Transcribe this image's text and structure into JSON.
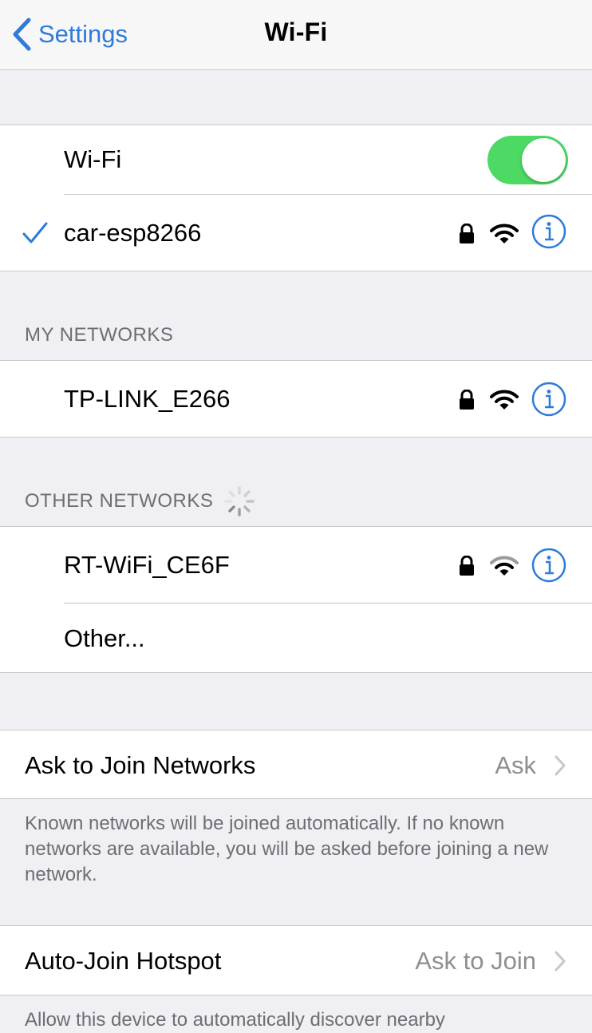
{
  "nav": {
    "back_label": "Settings",
    "title": "Wi-Fi"
  },
  "wifi_toggle": {
    "label": "Wi-Fi",
    "on": true,
    "color": "#4cd964"
  },
  "connected_network": {
    "name": "car-esp8266",
    "secured": true
  },
  "my_networks": {
    "header": "MY NETWORKS",
    "items": [
      {
        "name": "TP-LINK_E266",
        "secured": true
      }
    ]
  },
  "other_networks": {
    "header": "OTHER NETWORKS",
    "items": [
      {
        "name": "RT-WiFi_CE6F",
        "secured": true
      }
    ],
    "other_label": "Other..."
  },
  "ask_to_join": {
    "label": "Ask to Join Networks",
    "value": "Ask",
    "footer": "Known networks will be joined automatically. If no known networks are available, you will be asked before joining a new network."
  },
  "auto_join_hotspot": {
    "label": "Auto-Join Hotspot",
    "value": "Ask to Join",
    "footer": "Allow this device to automatically discover nearby"
  },
  "colors": {
    "accent": "#2f7bd9",
    "background": "#efeff4",
    "secondary_text": "#8e8e93"
  }
}
